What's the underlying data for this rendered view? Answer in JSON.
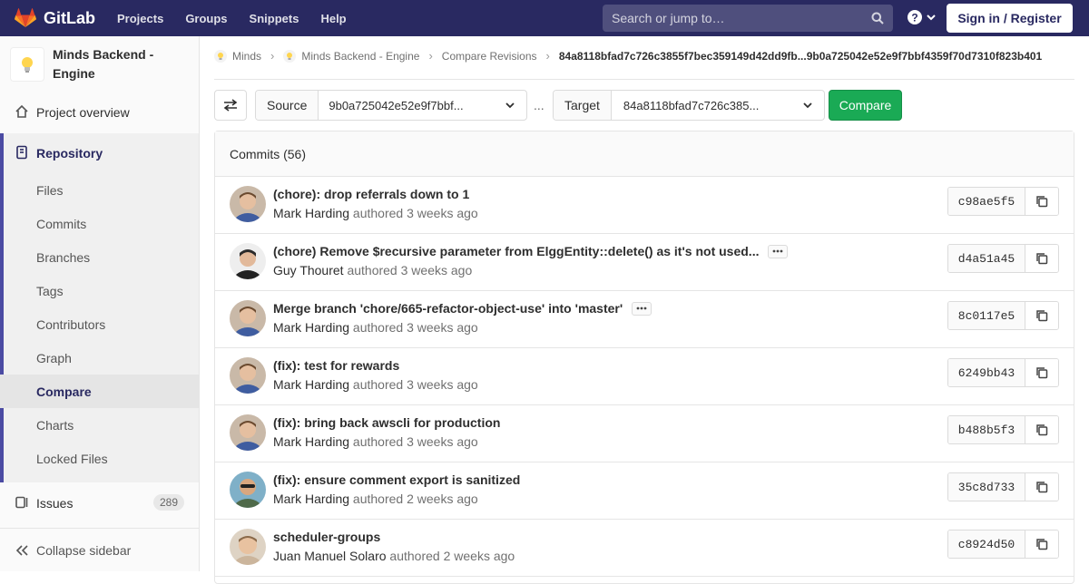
{
  "navbar": {
    "brand": "GitLab",
    "links": [
      "Projects",
      "Groups",
      "Snippets",
      "Help"
    ],
    "search_placeholder": "Search or jump to…",
    "signin": "Sign in / Register"
  },
  "sidebar": {
    "project_name": "Minds Backend - Engine",
    "overview": "Project overview",
    "repository": "Repository",
    "repo_items": [
      "Files",
      "Commits",
      "Branches",
      "Tags",
      "Contributors",
      "Graph",
      "Compare",
      "Charts",
      "Locked Files"
    ],
    "issues": "Issues",
    "issues_count": "289",
    "collapse": "Collapse sidebar"
  },
  "breadcrumb": {
    "items": [
      "Minds",
      "Minds Backend - Engine",
      "Compare Revisions"
    ],
    "current": "84a8118bfad7c726c3855f7bec359149d42dd9fb...9b0a725042e52e9f7bbf4359f70d7310f823b401"
  },
  "compare": {
    "source_label": "Source",
    "source_value": "9b0a725042e52e9f7bbf...",
    "dots": "...",
    "target_label": "Target",
    "target_value": "84a8118bfad7c726c385...",
    "button": "Compare"
  },
  "commits": {
    "header": "Commits (56)",
    "authored": "authored",
    "rows": [
      {
        "title": "(chore): drop referrals down to 1",
        "author": "Mark Harding",
        "time": "3 weeks ago",
        "sha": "c98ae5f5",
        "more": false,
        "avatar": "mark"
      },
      {
        "title": "(chore) Remove $recursive parameter from ElggEntity::delete() as it's not used...",
        "author": "Guy Thouret",
        "time": "3 weeks ago",
        "sha": "d4a51a45",
        "more": true,
        "avatar": "guy"
      },
      {
        "title": "Merge branch 'chore/665-refactor-object-use' into 'master'",
        "author": "Mark Harding",
        "time": "3 weeks ago",
        "sha": "8c0117e5",
        "more": true,
        "avatar": "mark"
      },
      {
        "title": "(fix): test for rewards",
        "author": "Mark Harding",
        "time": "3 weeks ago",
        "sha": "6249bb43",
        "more": false,
        "avatar": "mark"
      },
      {
        "title": "(fix): bring back awscli for production",
        "author": "Mark Harding",
        "time": "3 weeks ago",
        "sha": "b488b5f3",
        "more": false,
        "avatar": "mark"
      },
      {
        "title": "(fix): ensure comment export is sanitized",
        "author": "Mark Harding",
        "time": "2 weeks ago",
        "sha": "35c8d733",
        "more": false,
        "avatar": "mark2"
      },
      {
        "title": "scheduler-groups",
        "author": "Juan Manuel Solaro",
        "time": "2 weeks ago",
        "sha": "c8924d50",
        "more": false,
        "avatar": "juan"
      }
    ]
  }
}
